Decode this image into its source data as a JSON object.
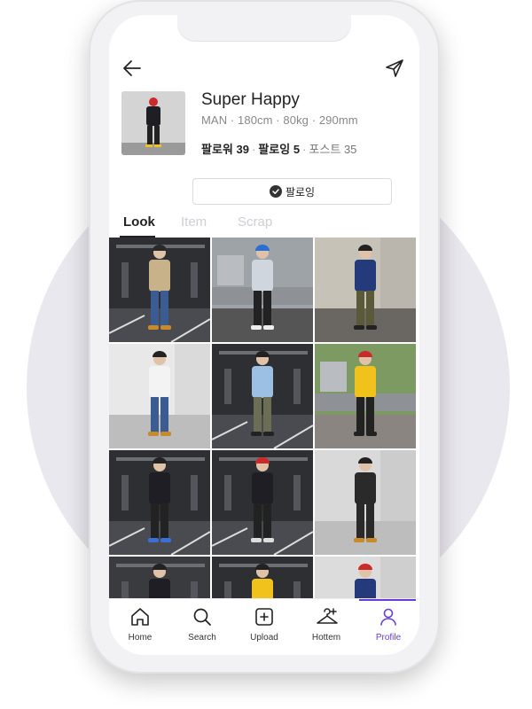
{
  "profile": {
    "name": "Super Happy",
    "meta": "MAN · 180cm · 80kg · 290mm",
    "followers_label": "팔로워",
    "followers_count": "39",
    "following_label": "팔로잉",
    "following_count": "5",
    "posts_label": "포스트",
    "posts_count": "35",
    "follow_button_label": "팔로잉"
  },
  "tabs": [
    {
      "label": "Look",
      "active": true
    },
    {
      "label": "Item",
      "active": false
    },
    {
      "label": "Scrap",
      "active": false
    }
  ],
  "grid": [
    {
      "scene": "parking",
      "bg": "#2e2f33",
      "floor": "#4a4b50",
      "top": "#c8b28a",
      "bottom": "#3b5c93",
      "hat": "#2a2a2a",
      "shoes": "#c98a2a"
    },
    {
      "scene": "street",
      "bg": "#9ea3a8",
      "floor": "#555555",
      "top": "#cfd6de",
      "bottom": "#222222",
      "hat": "#2a6fd6",
      "shoes": "#eeeeee"
    },
    {
      "scene": "wall",
      "bg": "#c7c2b8",
      "floor": "#6a6763",
      "top": "#253a7a",
      "bottom": "#5a5a3a",
      "hat": "#222222",
      "shoes": "#222222"
    },
    {
      "scene": "wall",
      "bg": "#e8e8e8",
      "floor": "#bdbdbd",
      "top": "#f3f3f3",
      "bottom": "#3b5c93",
      "hat": "#222222",
      "shoes": "#c98a2a"
    },
    {
      "scene": "parking",
      "bg": "#2e2f33",
      "floor": "#4a4b50",
      "top": "#9cc0e4",
      "bottom": "#6b6e55",
      "hat": "#222222",
      "shoes": "#222222"
    },
    {
      "scene": "street",
      "bg": "#7c9a62",
      "floor": "#8a8580",
      "top": "#f1c21b",
      "bottom": "#222222",
      "hat": "#cc2a2a",
      "shoes": "#222222"
    },
    {
      "scene": "parking",
      "bg": "#2e2f33",
      "floor": "#4a4b50",
      "top": "#1e1e24",
      "bottom": "#222222",
      "hat": "#222222",
      "shoes": "#3a6fd6"
    },
    {
      "scene": "parking",
      "bg": "#2e2f33",
      "floor": "#4a4b50",
      "top": "#1e1e24",
      "bottom": "#222222",
      "hat": "#cc2a2a",
      "shoes": "#dddddd"
    },
    {
      "scene": "wall",
      "bg": "#d9d9d9",
      "floor": "#bdbdbd",
      "top": "#2a2a2a",
      "bottom": "#2a2a2a",
      "hat": "#222222",
      "shoes": "#c98a2a"
    },
    {
      "scene": "parking",
      "bg": "#3a3b3f",
      "floor": "#4a4b50",
      "top": "#1e1e24",
      "bottom": "#222222",
      "hat": "#222222",
      "shoes": "#222222"
    },
    {
      "scene": "parking",
      "bg": "#2e2f33",
      "floor": "#4a4b50",
      "top": "#f1c21b",
      "bottom": "#222222",
      "hat": "#222222",
      "shoes": "#222222"
    },
    {
      "scene": "wall",
      "bg": "#dcdcdc",
      "floor": "#bdbdbd",
      "top": "#253a7a",
      "bottom": "#222222",
      "hat": "#cc2a2a",
      "shoes": "#222222"
    }
  ],
  "nav": [
    {
      "label": "Home",
      "icon": "home-icon",
      "active": false
    },
    {
      "label": "Search",
      "icon": "search-icon",
      "active": false
    },
    {
      "label": "Upload",
      "icon": "upload-icon",
      "active": false
    },
    {
      "label": "Hottem",
      "icon": "hanger-icon",
      "active": false
    },
    {
      "label": "Profile",
      "icon": "profile-icon",
      "active": true
    }
  ],
  "colors": {
    "accent": "#6a3ddb",
    "text": "#222222",
    "muted": "#888888",
    "tab_inactive": "#cfcfd4"
  }
}
